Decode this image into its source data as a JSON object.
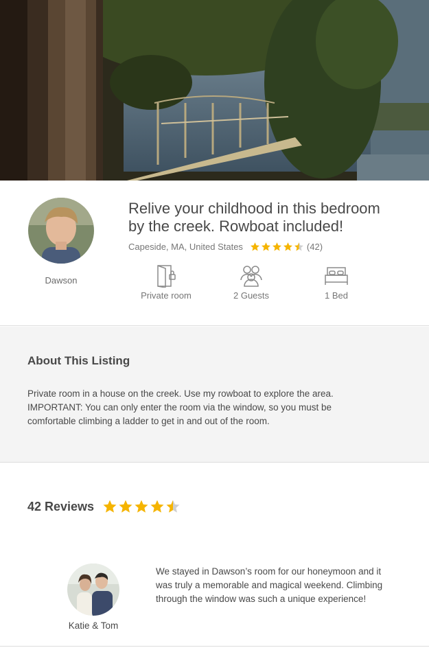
{
  "colors": {
    "star": "#f5b400",
    "star_empty": "#cfcfcf",
    "text": "#484848",
    "muted": "#767676",
    "panel": "#f4f4f4"
  },
  "host": {
    "name": "Dawson",
    "avatar_icon": "host-portrait"
  },
  "listing": {
    "title_line1": "Relive your childhood in this bedroom",
    "title_line2": "by the creek. Rowboat included!",
    "location": "Capeside, MA, United States",
    "rating": 4.5,
    "review_count_label": "(42)"
  },
  "amenities": [
    {
      "icon": "door-icon",
      "label": "Private room"
    },
    {
      "icon": "guests-icon",
      "label": "2 Guests"
    },
    {
      "icon": "bed-icon",
      "label": "1 Bed"
    }
  ],
  "about": {
    "heading": "About This Listing",
    "line1": "Private room in a house on the creek. Use my rowboat to explore the area.",
    "line2": "IMPORTANT: You can only enter the room via the window, so you must be",
    "line3": "comfortable climbing a ladder to get in and out of the room."
  },
  "reviews": {
    "heading": "42 Reviews",
    "rating": 4.5,
    "items": [
      {
        "reviewer": "Katie & Tom",
        "avatar_icon": "couple-photo",
        "line1": "We stayed in Dawson’s room for our honeymoon and it",
        "line2": "was truly a memorable and magical weekend. Climbing",
        "line3": "through the window was such a unique experience!"
      }
    ]
  }
}
